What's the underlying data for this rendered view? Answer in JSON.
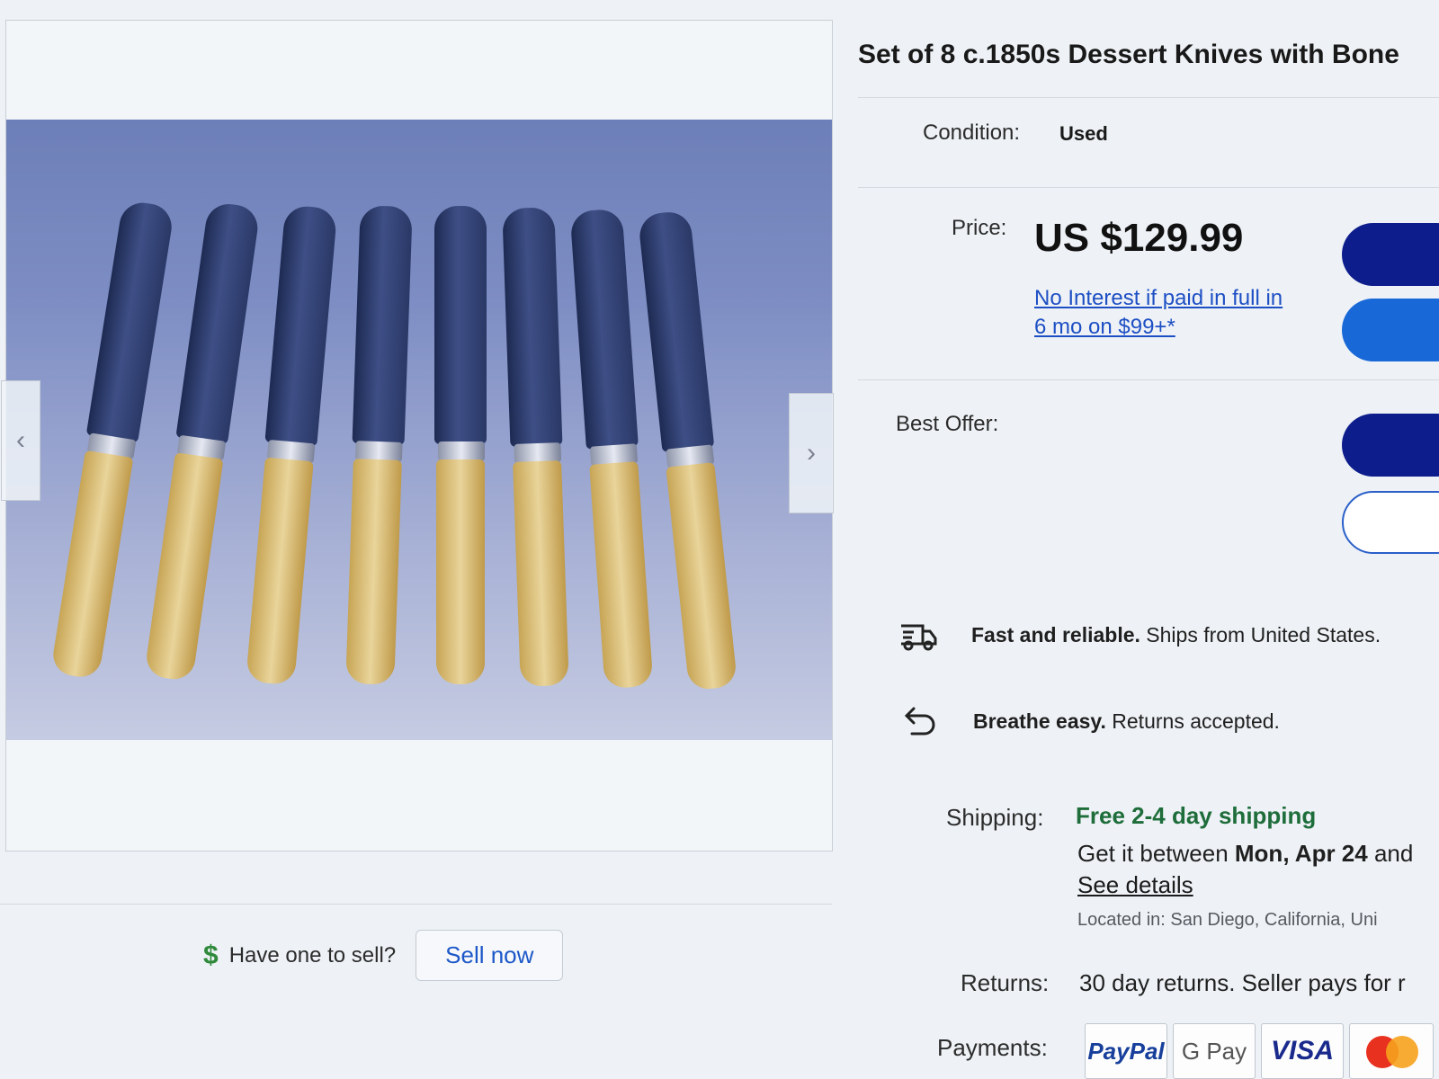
{
  "gallery": {
    "prev_arrow": "‹",
    "next_arrow": "›",
    "knife_count": 8
  },
  "sell": {
    "prompt": "Have one to sell?",
    "button": "Sell now",
    "icon": "$"
  },
  "item": {
    "title": "Set of 8 c.1850s Dessert Knives with Bone",
    "condition_label": "Condition:",
    "condition_value": "Used",
    "price_label": "Price:",
    "price_value": "US $129.99",
    "financing_line1": "No Interest if paid in full in",
    "financing_line2": "6 mo on $99+*",
    "best_offer_label": "Best Offer:"
  },
  "features": [
    {
      "icon": "truck-icon",
      "bold": "Fast and reliable.",
      "text": " Ships from United States."
    },
    {
      "icon": "return-arrow-icon",
      "bold": "Breathe easy.",
      "text": " Returns accepted."
    }
  ],
  "shipping": {
    "label": "Shipping:",
    "headline": "Free 2-4 day shipping",
    "delivery_prefix": "Get it between ",
    "delivery_date": "Mon, Apr 24",
    "delivery_suffix": " and",
    "details_link": "See details",
    "located": "Located in: San Diego, California, Uni"
  },
  "returns": {
    "label": "Returns:",
    "value": "30 day returns. Seller pays for r"
  },
  "payments": {
    "label": "Payments:",
    "methods": [
      "PayPal",
      "G Pay",
      "VISA",
      "Mastercard"
    ]
  },
  "colors": {
    "primary_button": "#0d1d8c",
    "secondary_button": "#1868d8",
    "link": "#1d4fc4",
    "shipping_green": "#1e6d3a"
  }
}
